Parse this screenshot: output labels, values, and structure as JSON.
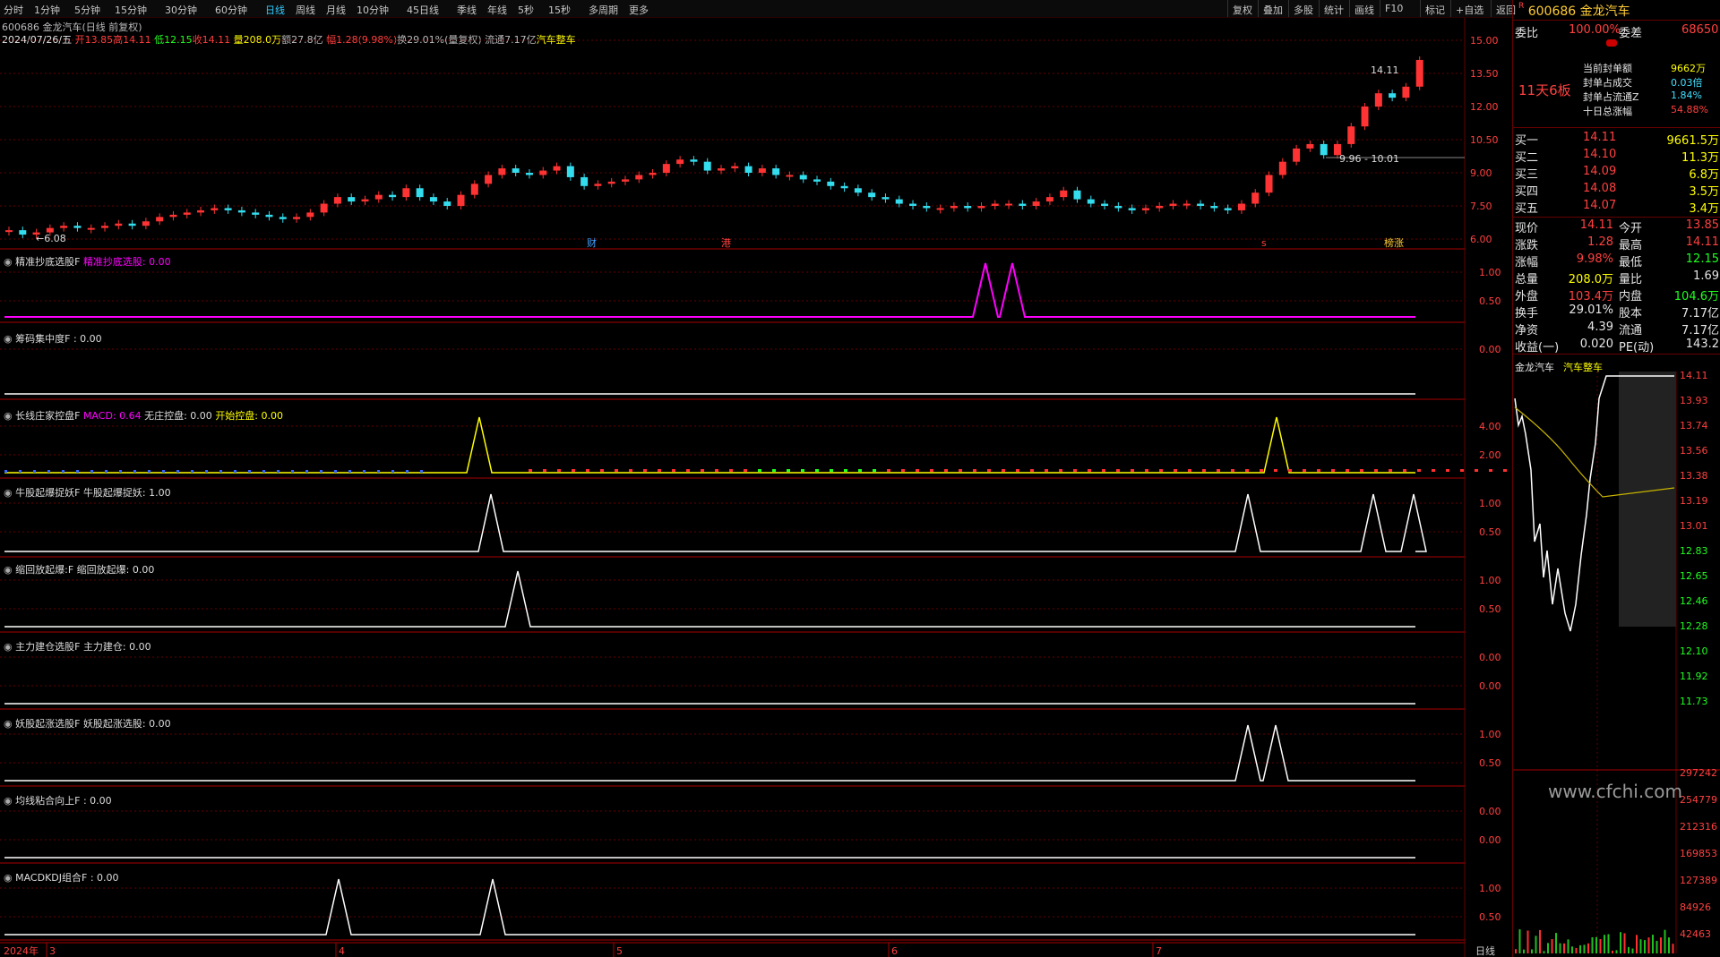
{
  "toolbar": {
    "timeframes": [
      "分时",
      "1分钟",
      "5分钟",
      "15分钟",
      "30分钟",
      "60分钟",
      "日线",
      "周线",
      "月线",
      "10分钟",
      "45日线",
      "季线",
      "年线",
      "5秒",
      "15秒",
      "多周期",
      "更多"
    ],
    "active_timeframe": "日线",
    "tools": [
      "复权",
      "叠加",
      "多股",
      "统计",
      "画线",
      "F10",
      "标记",
      "+自选",
      "返回"
    ]
  },
  "header": {
    "symbol_line": "600686 金龙汽车(日线 前复权)",
    "date": "2024/07/26/五",
    "open": "开13.85",
    "high": "高14.11",
    "low": "低12.15",
    "close": "收14.11",
    "volume": "量208.0万",
    "amount": "额27.8亿",
    "change": "幅1.28(9.98%)",
    "turnover": "换29.01%(量复权)",
    "float": "流通7.17亿",
    "sector": "汽车整车"
  },
  "main_chart": {
    "yticks": [
      "15.00",
      "13.50",
      "12.00",
      "10.50",
      "9.00",
      "7.50",
      "6.00"
    ],
    "annotations": {
      "high": "14.11",
      "low": "6.08",
      "range": "9.96 - 10.01"
    },
    "event_markers": [
      "财",
      "港",
      "s",
      "榜涨"
    ]
  },
  "indicators": [
    {
      "title": "精准抄底选股F",
      "label": "精准抄底选股:",
      "value": "0.00",
      "yticks": [
        "1.00",
        "0.50"
      ]
    },
    {
      "title": "筹码集中度F",
      "label": "",
      "value": ": 0.00",
      "yticks": [
        "0.00"
      ]
    },
    {
      "title": "长线庄家控盘F",
      "label": "MACD: 0.64",
      "label2": "无庄控盘: 0.00",
      "label3": "开始控盘: 0.00",
      "yticks": [
        "4.00",
        "2.00"
      ]
    },
    {
      "title": "牛股起爆捉妖F",
      "label": "牛股起爆捉妖:",
      "value": "1.00",
      "yticks": [
        "1.00",
        "0.50"
      ]
    },
    {
      "title": "缩回放起爆:F",
      "label": "缩回放起爆:",
      "value": "0.00",
      "yticks": [
        "1.00",
        "0.50"
      ]
    },
    {
      "title": "主力建仓选股F",
      "label": "主力建仓:",
      "value": "0.00",
      "yticks": [
        "0.00",
        "0.00"
      ]
    },
    {
      "title": "妖股起涨选股F",
      "label": "妖股起涨选股:",
      "value": "0.00",
      "yticks": [
        "1.00",
        "0.50"
      ]
    },
    {
      "title": "均线粘合向上F",
      "label": "",
      "value": ": 0.00",
      "yticks": [
        "0.00",
        "0.00"
      ]
    },
    {
      "title": "MACDKDJ组合F",
      "label": "",
      "value": ": 0.00",
      "yticks": [
        "1.00",
        "0.50"
      ]
    }
  ],
  "xaxis": {
    "year": "2024年",
    "months": [
      "3",
      "4",
      "5",
      "6",
      "7"
    ],
    "period": "日线"
  },
  "right_panel": {
    "code": "600686",
    "name": "金龙汽车",
    "weibi_label": "委比",
    "weibi": "100.00%",
    "weicha_label": "委差",
    "weicha": "68650",
    "streak": "11天6板",
    "seal": [
      {
        "label": "当前封单额",
        "value": "9662万"
      },
      {
        "label": "封单占成交",
        "value": "0.03倍"
      },
      {
        "label": "封单占流通Z",
        "value": "1.84%"
      },
      {
        "label": "十日总涨幅",
        "value": "54.88%"
      }
    ],
    "bids": [
      {
        "label": "买一",
        "price": "14.11",
        "vol": "9661.5万"
      },
      {
        "label": "买二",
        "price": "14.10",
        "vol": "11.3万"
      },
      {
        "label": "买三",
        "price": "14.09",
        "vol": "6.8万"
      },
      {
        "label": "买四",
        "price": "14.08",
        "vol": "3.5万"
      },
      {
        "label": "买五",
        "price": "14.07",
        "vol": "3.4万"
      }
    ],
    "stats": [
      {
        "l1": "现价",
        "v1": "14.11",
        "l2": "今开",
        "v2": "13.85"
      },
      {
        "l1": "涨跌",
        "v1": "1.28",
        "l2": "最高",
        "v2": "14.11"
      },
      {
        "l1": "涨幅",
        "v1": "9.98%",
        "l2": "最低",
        "v2": "12.15"
      },
      {
        "l1": "总量",
        "v1": "208.0万",
        "l2": "量比",
        "v2": "1.69"
      },
      {
        "l1": "外盘",
        "v1": "103.4万",
        "l2": "内盘",
        "v2": "104.6万"
      },
      {
        "l1": "换手",
        "v1": "29.01%",
        "l2": "股本",
        "v2": "7.17亿"
      },
      {
        "l1": "净资",
        "v1": "4.39",
        "l2": "流通",
        "v2": "7.17亿"
      },
      {
        "l1": "收益(一)",
        "v1": "0.020",
        "l2": "PE(动)",
        "v2": "143.2"
      }
    ],
    "mini_title": "金龙汽车",
    "mini_sector": "汽车整车",
    "mini_prices": [
      "14.11",
      "13.93",
      "13.74",
      "13.56",
      "13.38",
      "13.19",
      "13.01",
      "12.83",
      "12.65",
      "12.46",
      "12.28",
      "12.10",
      "11.92",
      "11.73"
    ],
    "mini_vols": [
      "297242",
      "254779",
      "212316",
      "169853",
      "127389",
      "84926",
      "42463"
    ]
  },
  "watermark": "www.cfchi.com",
  "colors": {
    "up": "#ff3333",
    "down": "#33ddee",
    "grid": "#660000"
  }
}
